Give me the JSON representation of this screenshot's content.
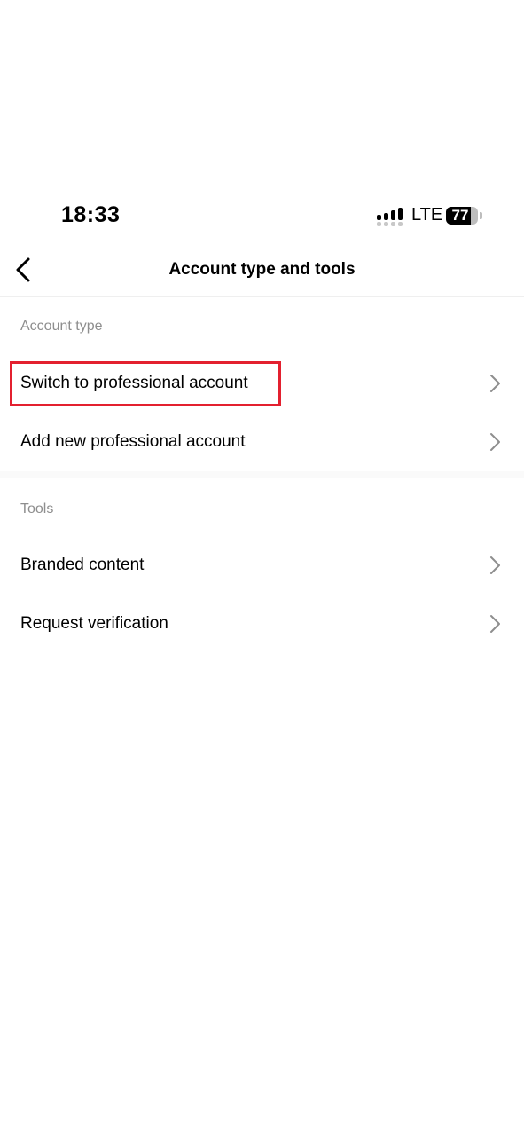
{
  "status_bar": {
    "time": "18:33",
    "network": "LTE",
    "battery_level": 77,
    "battery_label": "77"
  },
  "nav": {
    "back_icon": "chevron-left-icon",
    "title": "Account type and tools"
  },
  "sections": [
    {
      "label": "Account type",
      "items": [
        {
          "label": "Switch to professional account",
          "icon": "chevron-right-icon",
          "highlighted": true
        },
        {
          "label": "Add new professional account",
          "icon": "chevron-right-icon"
        }
      ]
    },
    {
      "label": "Tools",
      "items": [
        {
          "label": "Branded content",
          "icon": "chevron-right-icon"
        },
        {
          "label": "Request verification",
          "icon": "chevron-right-icon"
        }
      ]
    }
  ],
  "colors": {
    "highlight": "#e3202f",
    "section_label": "#8e8e8e",
    "chevron": "#8e8e8e"
  }
}
